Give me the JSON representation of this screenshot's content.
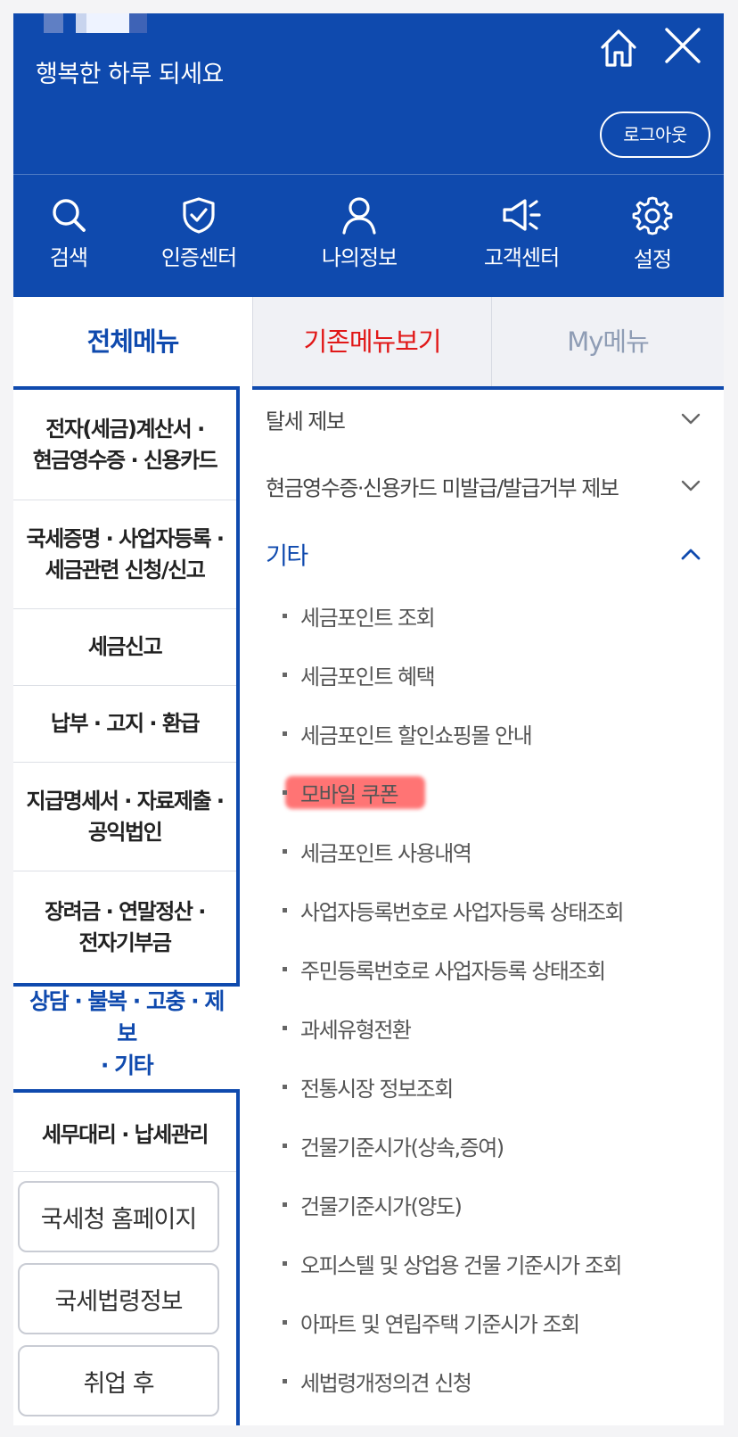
{
  "header": {
    "greeting": "행복한 하루 되세요",
    "logout_label": "로그아웃",
    "background_color": "#0f4aae",
    "quick_menu": [
      {
        "label": "검색",
        "icon": "search-icon"
      },
      {
        "label": "인증센터",
        "icon": "shield-check-icon"
      },
      {
        "label": "나의정보",
        "icon": "user-icon"
      },
      {
        "label": "고객센터",
        "icon": "megaphone-icon"
      },
      {
        "label": "설정",
        "icon": "gear-icon"
      }
    ]
  },
  "tabs": [
    {
      "label": "전체메뉴",
      "active": true,
      "color": "#0f4aae"
    },
    {
      "label": "기존메뉴보기",
      "color": "#e11818"
    },
    {
      "label": "My메뉴",
      "color": "#8f9db5"
    }
  ],
  "left_menu": {
    "items": [
      {
        "line1": "전자(세금)계산서 ·",
        "line2": "현금영수증 · 신용카드"
      },
      {
        "line1": "국세증명 · 사업자등록 ·",
        "line2": "세금관련 신청/신고"
      },
      {
        "line1": "세금신고",
        "line2": ""
      },
      {
        "line1": "납부 · 고지 · 환급",
        "line2": ""
      },
      {
        "line1": "지급명세서 · 자료제출 ·",
        "line2": "공익법인"
      },
      {
        "line1": "장려금 · 연말정산 ·",
        "line2": "전자기부금"
      }
    ],
    "active": {
      "line1": "상담 · 불복 · 고충 · 제보",
      "line2": "· 기타"
    },
    "tax_agent": "세무대리 · 납세관리",
    "link_buttons": [
      "국세청 홈페이지",
      "국세법령정보",
      "취업 후"
    ]
  },
  "right_menu": {
    "sections": [
      {
        "label": "탈세 제보",
        "expanded": false
      },
      {
        "label": "현금영수증·신용카드 미발급/발급거부 제보",
        "expanded": false
      },
      {
        "label": "기타",
        "expanded": true
      }
    ],
    "sub_items": [
      {
        "label": "세금포인트 조회",
        "highlighted": false
      },
      {
        "label": "세금포인트 혜택",
        "highlighted": false
      },
      {
        "label": "세금포인트 할인쇼핑몰 안내",
        "highlighted": false
      },
      {
        "label": "모바일 쿠폰",
        "highlighted": true
      },
      {
        "label": "세금포인트 사용내역",
        "highlighted": false
      },
      {
        "label": "사업자등록번호로 사업자등록 상태조회",
        "highlighted": false
      },
      {
        "label": "주민등록번호로 사업자등록 상태조회",
        "highlighted": false
      },
      {
        "label": "과세유형전환",
        "highlighted": false
      },
      {
        "label": "전통시장 정보조회",
        "highlighted": false
      },
      {
        "label": "건물기준시가(상속,증여)",
        "highlighted": false
      },
      {
        "label": "건물기준시가(양도)",
        "highlighted": false
      },
      {
        "label": "오피스텔 및 상업용 건물 기준시가 조회",
        "highlighted": false
      },
      {
        "label": "아파트 및 연립주택 기준시가 조회",
        "highlighted": false
      },
      {
        "label": "세법령개정의견 신청",
        "highlighted": false
      }
    ]
  }
}
